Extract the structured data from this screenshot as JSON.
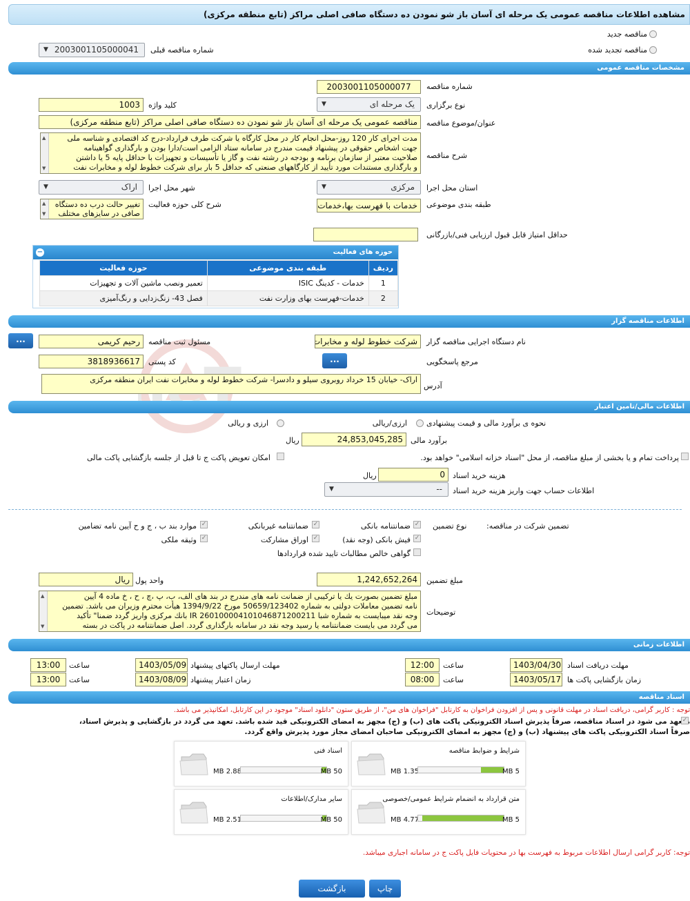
{
  "page_title": "مشاهده اطلاعات مناقصه عمومی یک مرحله ای آسان باز شو نمودن ده دستگاه صافی اصلی مراکز (تابع منطقه مرکزی)",
  "tender_type": {
    "new": "مناقصه جدید",
    "renewed": "مناقصه تجدید شده",
    "prev_number_label": "شماره مناقصه قبلی",
    "prev_number": "2003001105000041"
  },
  "general": {
    "section_title": "مشخصات مناقصه عمومی",
    "number_label": "شماره مناقصه",
    "number": "2003001105000077",
    "hold_type_label": "نوع برگزاری",
    "hold_type": "یک مرحله ای",
    "keyword_label": "کلید واژه",
    "keyword": "1003",
    "subject_label": "عنوان/موضوع مناقصه",
    "subject": "مناقصه عمومی یک مرحله ای  آسان باز شو نمودن ده دستگاه صافی اصلی مراکز (تابع منطقه مرکزی)",
    "desc_label": "شرح مناقصه",
    "desc_lines": [
      "مدت اجرای کار 120 روز-محل انجام کار در محل کارگاه یا شرکت طرف قرارداد-درج کد اقتصادی و شناسه ملی",
      "جهت اشخاص حقوقی در پیشنهاد قیمت مندرج در سامانه ستاد الزامی است/دارا بودن و بارگذاری گواهینامه",
      "صلاحیت معتبر از سازمان برنامه و بودجه در رشته نفت و گاز یا تأسیسات و تجهیزات با حداقل پایه 5 یا داشتن",
      "و بارگذاری مستندات مورد تأیید از کارگاههای صنعتی که حداقل 5 بار برای شرکت خطوط لوله و مخابرات نفت"
    ],
    "province_label": "استان محل اجرا",
    "province": "مرکزی",
    "city_label": "شهر محل اجرا",
    "city": "اراک",
    "category_label": "طبقه بندی موضوعی",
    "category": "خدمات با فهرست بها،خدمات",
    "activity_label": "شرح کلی حوزه فعالیت",
    "activity_lines": [
      "تغییر حالت درب ده دستگاه",
      "صافی در سایزهای مختلف"
    ],
    "min_score_label": "حداقل امتیاز قابل قبول ارزیابی فنی/بازرگانی",
    "min_score": ""
  },
  "activities": {
    "title": "حوزه های فعالیت",
    "headers": [
      "ردیف",
      "طبقه بندی موضوعی",
      "حوزه فعالیت"
    ],
    "rows": [
      {
        "n": "1",
        "cat": "خدمات - کدینگ ISIC",
        "field": "تعمیر ونصب ماشین آلات و تجهیزات"
      },
      {
        "n": "2",
        "cat": "خدمات-فهرست بهای وزارت نفت",
        "field": "فصل 43- زنگ‌زدایی و رنگ‌آمیزی"
      }
    ]
  },
  "organizer": {
    "section_title": "اطلاعات مناقصه گزار",
    "org_label": "نام دستگاه اجرایی مناقصه گزار",
    "org": "شرکت خطوط لوله و مخابرات نفت ایران",
    "responsible_label": "مسئول ثبت مناقصه",
    "responsible": "رحیم کریمی",
    "ref_label": "مرجع پاسخگویی",
    "postal_label": "کد پستی",
    "postal": "3818936617",
    "address_label": "آدرس",
    "address": "اراک- خیابان 15 خرداد روبروی سیلو و دادسرا- شرکت خطوط لوله و مخابرات نفت ایران منطقه مرکزی",
    "dots": "..."
  },
  "finance": {
    "section_title": "اطلاعات مالی/تامین اعتبار",
    "estimate_method_label": "نحوه ی برآورد مالی و قیمت پیشنهادی",
    "opt_rial": "ارزی/ریالی",
    "opt_both": "ارزی و ریالی",
    "estimate_label": "برآورد مالی",
    "estimate": "24,853,045,285",
    "rial": "ریال",
    "treasury_text": "پرداخت تمام و یا بخشی از مبلغ مناقصه، از محل \"اسناد خزانه اسلامی\" خواهد بود.",
    "swap_text": "امکان تعویض پاکت ج تا قبل از جلسه بازگشایی پاکت مالی",
    "doc_fee_label": "هزینه خرید اسناد",
    "doc_fee": "0",
    "account_label": "اطلاعات حساب جهت واریز هزینه خرید اسناد",
    "account": "--"
  },
  "guarantee": {
    "participation_label": "تضمین شرکت در مناقصه:",
    "type_label": "نوع تضمین",
    "options": [
      "ضمانتنامه بانکی",
      "ضمانتنامه غیربانکی",
      "موارد بند ب ، ج و ح آیین نامه تضامین",
      "فیش بانکی (وجه نقد)",
      "اوراق مشارکت",
      "وثیقه ملکی",
      "گواهی خالص مطالبات تایید شده قراردادها"
    ],
    "amount_label": "مبلغ تضمین",
    "amount": "1,242,652,264",
    "currency_label": "واحد پول",
    "currency": "ریال",
    "notes_label": "توضیحات",
    "notes_lines": [
      "مبلغ تضمین بصورت یك یا تركیبی از ضمانت نامه های مندرج در بند های الف، ب، پ ،چ ، ح ، خ ماده 4 آیین",
      "نامه تضمین معاملات دولتی به شماره 50659/123402 مورخ 1394/9/22 هیأت محترم وزیران می باشد. تضمین",
      "وجه نقد  میبایست به شماره شبا IR 260100004101046871200211 بانك مركزی واریز گردد ضمنا\"  تأكید",
      "می گردد می بایست ضمانتنامه یا رسید وجه نقد در سامانه بارگذاری گردد. اصل ضمانتنامه در پاكت در بسته"
    ]
  },
  "timing": {
    "section_title": "اطلاعات زمانی",
    "receive_label": "مهلت دریافت اسناد",
    "receive_date": "1403/04/30",
    "receive_time": "12:00",
    "send_label": "مهلت ارسال پاکتهای پیشنهاد",
    "send_date": "1403/05/09",
    "send_time": "13:00",
    "open_label": "زمان بازگشایی پاکت ها",
    "open_date": "1403/05/17",
    "open_time": "08:00",
    "validity_label": "زمان اعتبار پیشنهاد",
    "validity_date": "1403/08/09",
    "validity_time": "13:00",
    "time_label": "ساعت"
  },
  "docs": {
    "section_title": "اسناد مناقصه",
    "note1_prefix": "توجه :",
    "note1": " کاربر گرامی، دریافت اسناد در مهلت قانونی و پس از افزودن فراخوان به کارتابل \"فراخوان های من\"، از طریق ستون \"دانلود اسناد\" موجود در این کارتابل، امکانپذیر می باشد.",
    "bold_lines": [
      "متعهد می شود در اسناد مناقصه، صرفاً پذیرش اسناد الکترونیکی پاکت های (ب) و (ج) مجهز به امضای الکترونیکی قید شده باشد. تعهد می گردد در بازگشایی و پذیرش اسناد،",
      "صرفاً اسناد الکترونیکی پاکت های پیشنهاد (ب) و (ج) مجهز به امضای الکترونیکی صاحبان امضای مجاز مورد پذیرش واقع گردد."
    ],
    "files": [
      {
        "title": "شرایط و ضوابط مناقصه",
        "size": "1.35 MB",
        "max": "5 MB",
        "ratio": 0.27
      },
      {
        "title": "اسناد فنی",
        "size": "2.88 MB",
        "max": "50 MB",
        "ratio": 0.06
      },
      {
        "title": "متن قرارداد به انضمام شرایط عمومی/خصوصی",
        "size": "4.77 MB",
        "max": "5 MB",
        "ratio": 0.95
      },
      {
        "title": "سایر مدارک/اطلاعات",
        "size": "2.51 MB",
        "max": "50 MB",
        "ratio": 0.05
      }
    ],
    "note2_prefix": "توجه:",
    "note2": " کاربر گرامی ارسال اطلاعات مربوط به فهرست بها در محتویات فایل پاکت ج در سامانه اجباری میباشد."
  },
  "buttons": {
    "back": "بازگشت",
    "print": "چاپ"
  },
  "watermark": "AriaTender.neT",
  "colors": {
    "section": "#2f8fd3",
    "input": "#ffffc6",
    "progress": "#8cc63f",
    "red": "#d92020"
  }
}
